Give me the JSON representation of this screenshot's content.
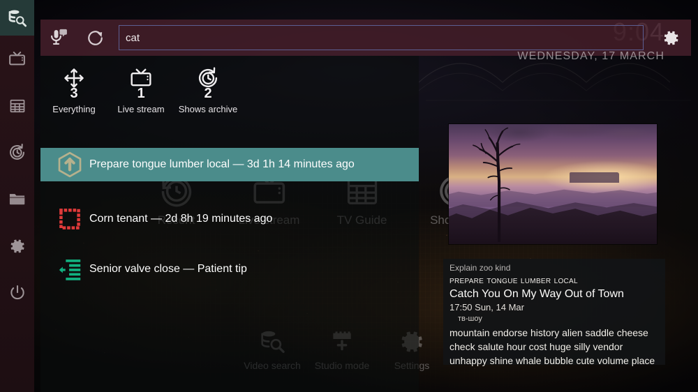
{
  "app": {
    "clock": "9:04",
    "date": "WEDNESDAY, 17 MARCH",
    "accent_teal": "#4b8c8b",
    "accent_maroon": "#4a212d",
    "rail_active_bg": "#253a38"
  },
  "sidebar": {
    "items": [
      {
        "name": "video-search",
        "label": "Video search",
        "active": true
      },
      {
        "name": "tv",
        "label": "TV",
        "active": false
      },
      {
        "name": "tv-guide",
        "label": "TV Guide",
        "active": false
      },
      {
        "name": "recent",
        "label": "Recent",
        "active": false
      },
      {
        "name": "files",
        "label": "Files",
        "active": false
      },
      {
        "name": "settings",
        "label": "Settings",
        "active": false
      },
      {
        "name": "power",
        "label": "Power",
        "active": false
      }
    ]
  },
  "search": {
    "value": "cat",
    "placeholder": "",
    "voice_icon": "microphone-speech-icon",
    "refresh_icon": "refresh-icon",
    "settings_icon": "gear-icon"
  },
  "filters": {
    "tabs": [
      {
        "label": "Everything",
        "count": "3",
        "icon": "move-arrows-icon"
      },
      {
        "label": "Live stream",
        "count": "1",
        "icon": "tv-icon"
      },
      {
        "label": "Shows archive",
        "count": "2",
        "icon": "history-icon"
      }
    ]
  },
  "results": {
    "rows": [
      {
        "label": "Prepare tongue lumber local — 3d 1h 14 minutes ago",
        "icon": "hexagon-up-arrow-icon",
        "selected": true
      },
      {
        "label": "Corn tenant — 2d 8h 19 minutes ago",
        "icon": "dotted-square-icon",
        "selected": false
      },
      {
        "label": "Senior valve close — Patient tip",
        "icon": "indent-left-icon",
        "selected": false
      }
    ]
  },
  "background_menu": {
    "main": [
      {
        "label": "Recent",
        "icon": "history-icon"
      },
      {
        "label": "Live stream",
        "icon": "tv-icon"
      },
      {
        "label": "TV Guide",
        "icon": "grid-icon"
      },
      {
        "label": "Shows ar",
        "icon": "history-rotate-icon"
      }
    ],
    "bottom": [
      {
        "label": "Video search",
        "icon": "database-search-icon"
      },
      {
        "label": "Studio mode",
        "icon": "studio-plus-icon"
      },
      {
        "label": "Settings",
        "icon": "gear-icon"
      }
    ]
  },
  "preview": {
    "thumbnail_alt": "purple sunset canyon with bare tree silhouette",
    "info": {
      "kind": "Explain zoo kind",
      "channel": "Prepare tongue lumber local",
      "title": "Catch You On My Way Out of Town",
      "time": "17:50 Sun, 14 Mar",
      "genre": "тв-шоу",
      "description": "mountain endorse history alien saddle cheese check salute hour cost huge silly vendor unhappy shine whale bubble cute volume place"
    }
  }
}
